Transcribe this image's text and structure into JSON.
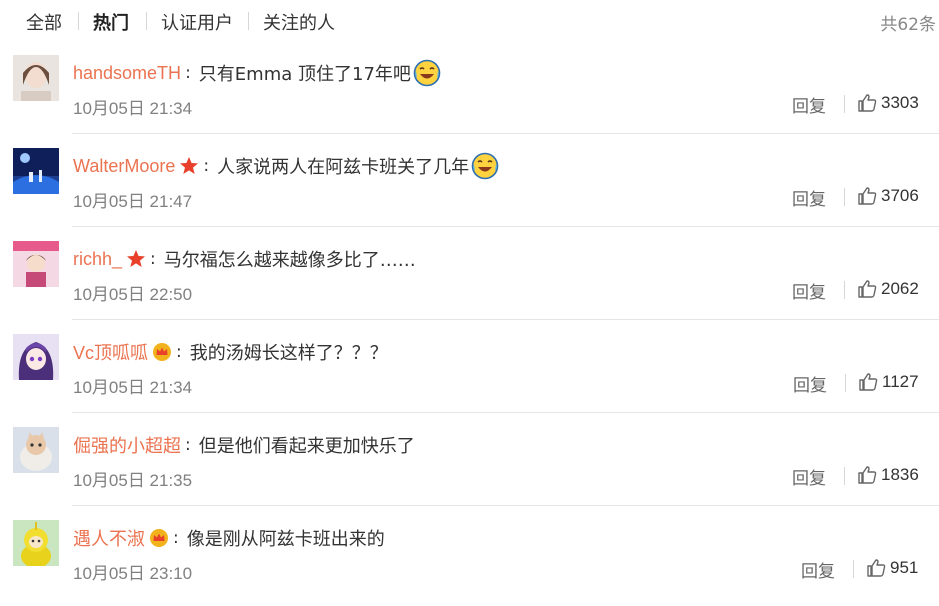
{
  "tabs": [
    {
      "label": "全部",
      "active": false
    },
    {
      "label": "热门",
      "active": true
    },
    {
      "label": "认证用户",
      "active": false
    },
    {
      "label": "关注的人",
      "active": false
    }
  ],
  "total_count": "共62条",
  "reply_label": "回复",
  "colors": {
    "username": "#eb7350",
    "badge_star": "#e8402b",
    "badge_crown": "#f2b21c"
  },
  "comments": [
    {
      "username": "handsomeTH",
      "badge": null,
      "text": "只有Emma 顶住了17年吧",
      "emoji": "laugh-cry-emoji",
      "time": "10月05日 21:34",
      "likes": "3303"
    },
    {
      "username": "WalterMoore",
      "badge": "star-badge-icon",
      "text": "人家说两人在阿兹卡班关了几年",
      "emoji": "laugh-cry-emoji",
      "time": "10月05日 21:47",
      "likes": "3706"
    },
    {
      "username": "richh_",
      "badge": "star-badge-icon",
      "text": "马尔福怎么越来越像多比了……",
      "emoji": null,
      "time": "10月05日 22:50",
      "likes": "2062"
    },
    {
      "username": "Vc顶呱呱",
      "badge": "crown-badge-icon",
      "text": "我的汤姆长这样了？？？",
      "emoji": null,
      "time": "10月05日 21:34",
      "likes": "1127"
    },
    {
      "username": "倔强的小超超",
      "badge": null,
      "text": "但是他们看起来更加快乐了",
      "emoji": null,
      "time": "10月05日 21:35",
      "likes": "1836"
    },
    {
      "username": "遇人不淑",
      "badge": "crown-badge-icon",
      "text": "像是刚从阿兹卡班出来的",
      "emoji": null,
      "time": "10月05日 23:10",
      "likes": "951"
    }
  ]
}
